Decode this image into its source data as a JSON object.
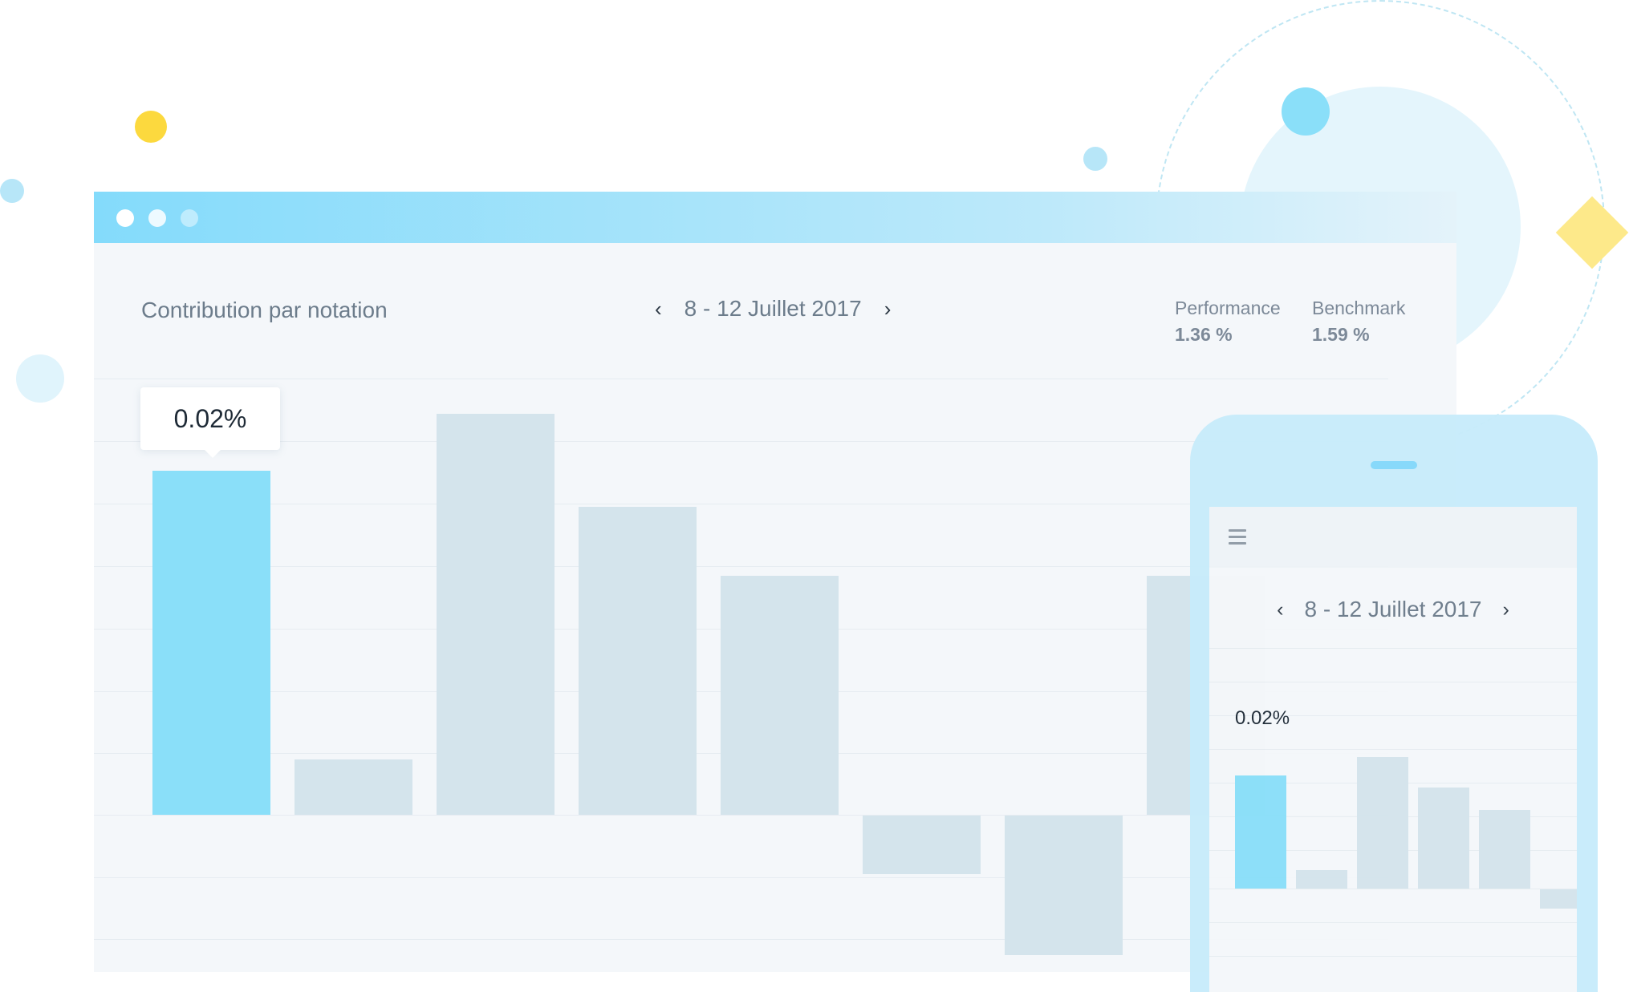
{
  "colors": {
    "accent": "#8adff9",
    "bar_muted": "#d4e4ec",
    "yellow": "#fcd93e",
    "light_blue": "#aee4f8"
  },
  "desktop": {
    "title": "Contribution par notation",
    "date_range": "8 - 12 Juillet 2017",
    "prev_icon": "chevron-left-icon",
    "next_icon": "chevron-right-icon",
    "stats": [
      {
        "label": "Performance",
        "value": "1.36 %"
      },
      {
        "label": "Benchmark",
        "value": "1.59 %"
      }
    ],
    "tooltip": "0.02%"
  },
  "mobile": {
    "menu_icon": "hamburger-menu-icon",
    "date_range": "8 - 12 Juillet 2017",
    "selected_value": "0.02%"
  },
  "chart_data": [
    {
      "type": "bar",
      "values": [
        0.02,
        0.0032,
        0.0233,
        0.0179,
        0.0139,
        -0.0034,
        -0.0081,
        0.0139
      ],
      "highlighted_index": 0,
      "grid": true
    },
    {
      "type": "bar",
      "values": [
        0.02,
        0.0032,
        0.0233,
        0.0179,
        0.0139,
        -0.0034
      ],
      "highlighted_index": 0,
      "grid": true
    }
  ]
}
